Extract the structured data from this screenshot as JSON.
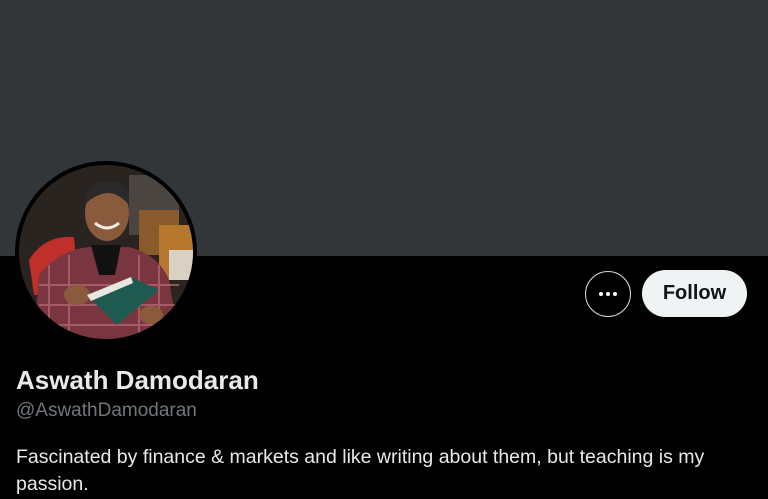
{
  "profile": {
    "display_name": "Aswath Damodaran",
    "handle": "@AswathDamodaran",
    "bio": "Fascinated by finance & markets and like writing about them, but teaching is my passion.",
    "avatar_icon": "profile-photo"
  },
  "actions": {
    "more_icon": "ellipsis-icon",
    "follow_label": "Follow"
  },
  "colors": {
    "background": "#000000",
    "banner": "#333639",
    "name_text": "#e7e9ea",
    "handle_text": "#71767b",
    "follow_bg": "#eff3f4",
    "follow_text": "#0f1419"
  }
}
